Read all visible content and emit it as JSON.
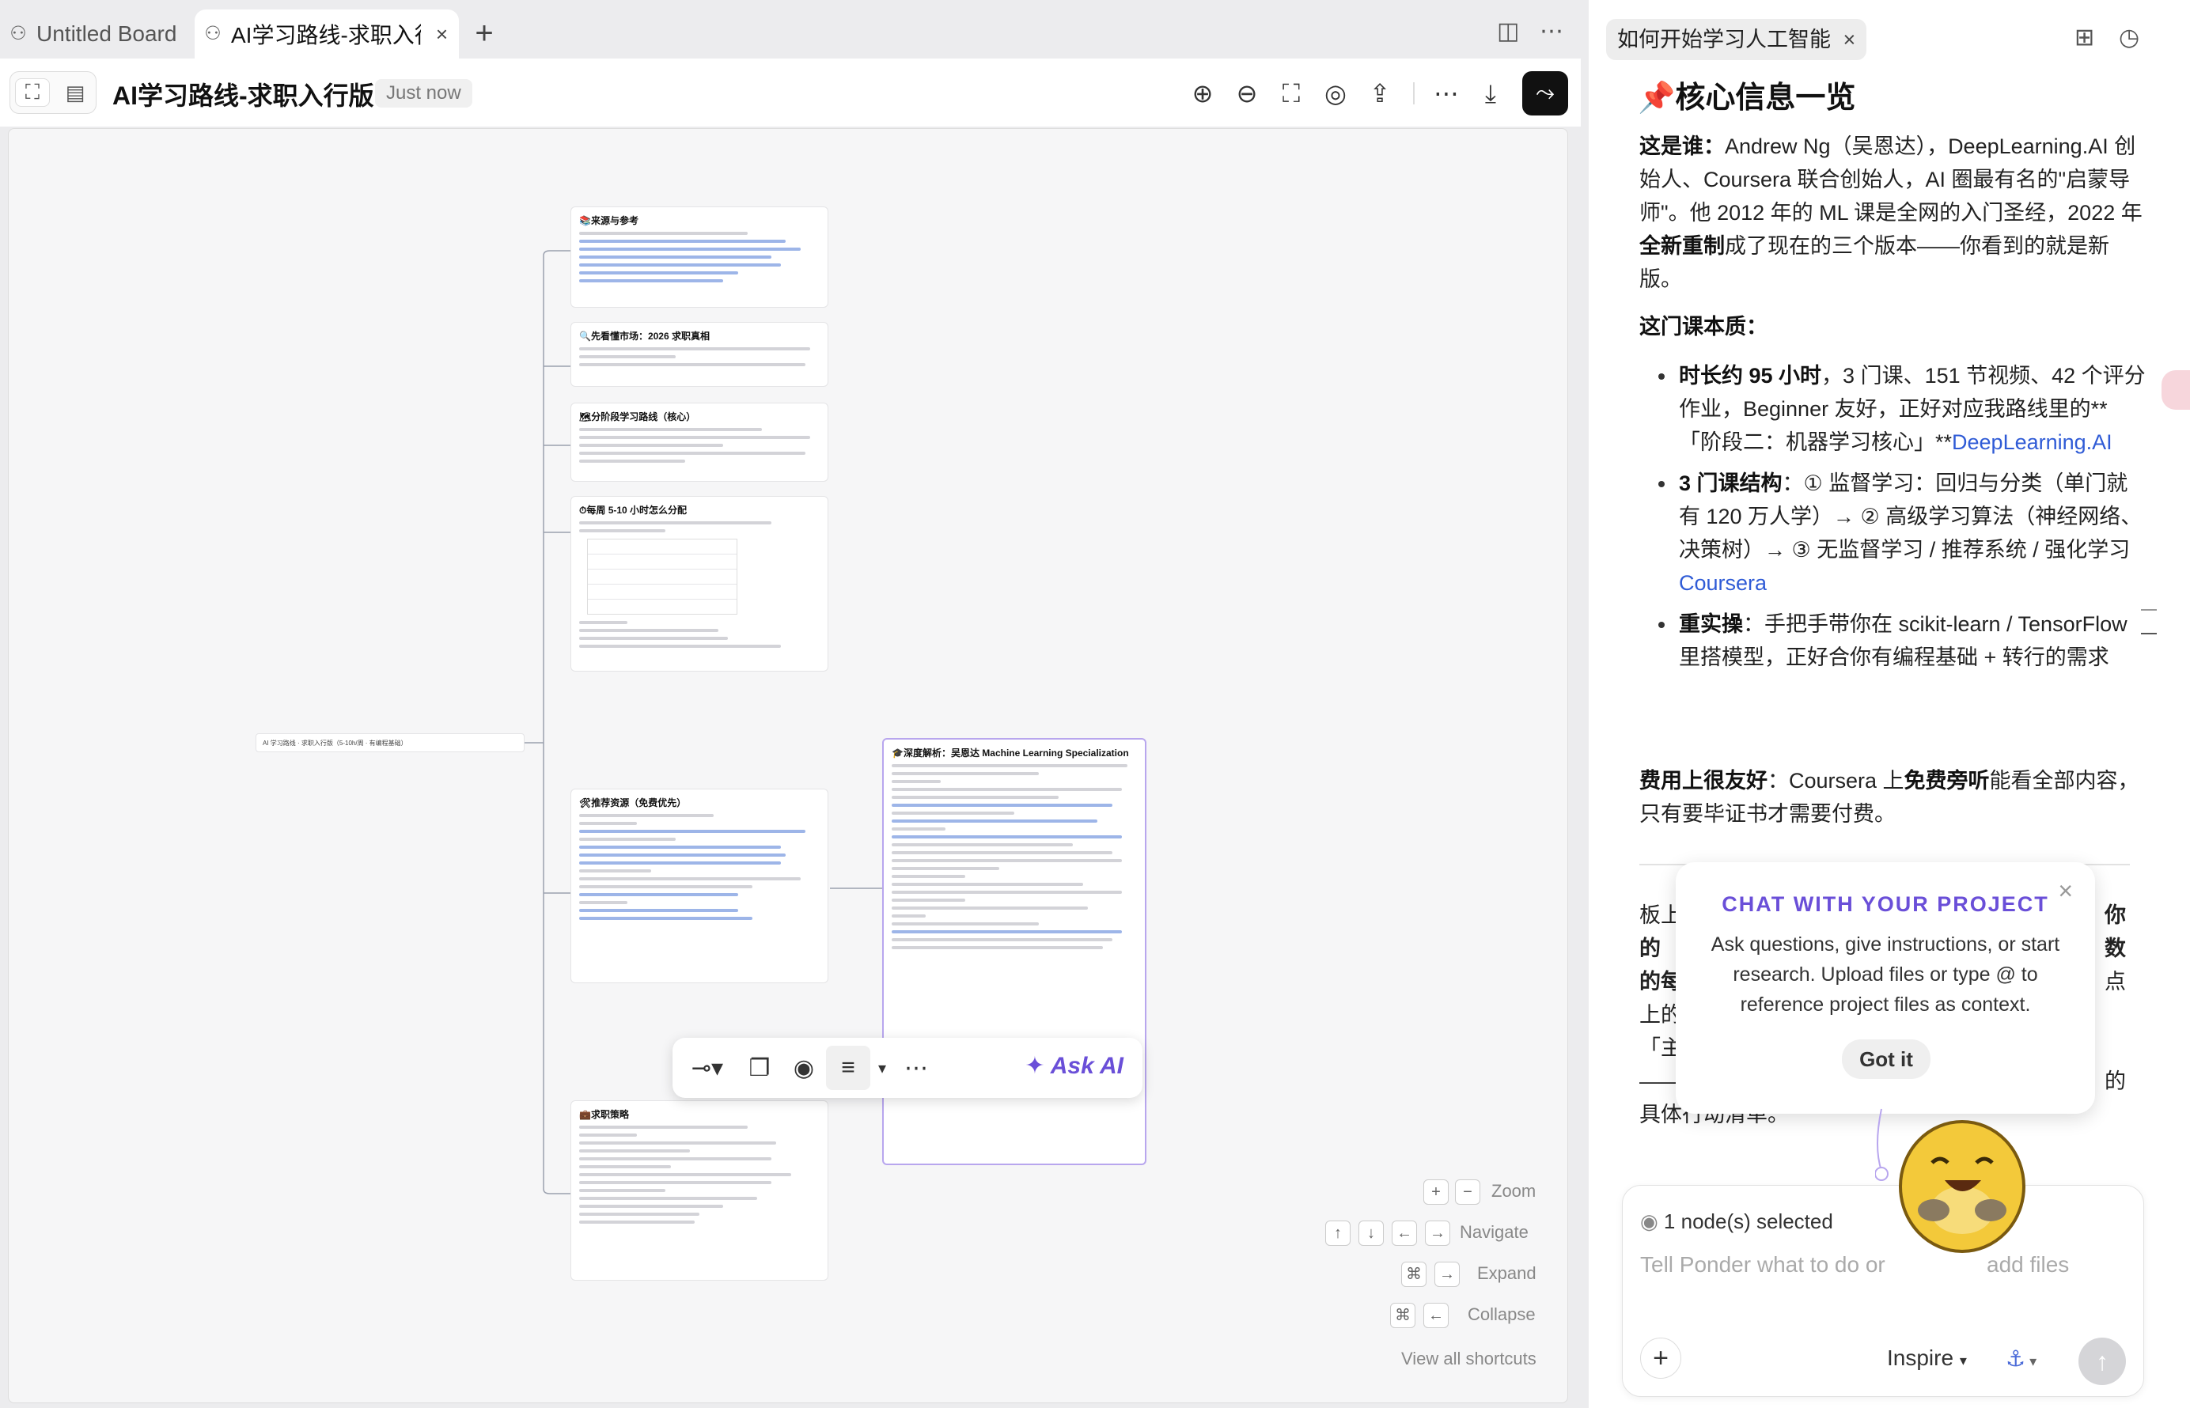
{
  "tabs": [
    {
      "label": "Untitled Board"
    },
    {
      "label": "AI学习路线-求职入行版"
    }
  ],
  "header": {
    "title": "AI学习路线-求职入行版",
    "save_status": "Just now"
  },
  "canvas": {
    "root_node": "AI 学习路线 · 求职入行版（5-10h/周 · 有编程基础）",
    "cards": [
      {
        "title": "📚来源与参考"
      },
      {
        "title": "🔍先看懂市场：2026 求职真相"
      },
      {
        "title": "🗺分阶段学习路线（核心）"
      },
      {
        "title": "⏱每周 5-10 小时怎么分配"
      },
      {
        "title": "🛠推荐资源（免费优先）"
      },
      {
        "title": "💼求职策略"
      },
      {
        "title": "🎓深度解析：吴恩达 Machine Learning Specialization"
      }
    ],
    "shortcuts": [
      {
        "label": "Zoom"
      },
      {
        "label": "Navigate"
      },
      {
        "label": "Expand"
      },
      {
        "label": "Collapse"
      }
    ],
    "view_all": "View all shortcuts"
  },
  "floating_toolbar": {
    "ask_ai": "Ask AI"
  },
  "panel": {
    "chip": "如何开始学习人工智能",
    "heading": "📌核心信息一览",
    "p1_label": "这是谁：",
    "p1_text": "Andrew Ng（吴恩达），DeepLearning.AI 创始人、Coursera 联合创始人，AI 圈最有名的\"启蒙导师\"。他 2012 年的 ML 课是全网的入门圣经，2022 年",
    "p1_bold": "全新重制",
    "p1_tail": "成了现在的三个版本——你看到的就是新版。",
    "p2_label": "这门课本质：",
    "b1_bold": "时长约 95 小时",
    "b1_text": "，3 门课、151 节视频、42 个评分作业，Beginner 友好，正好对应我路线里的**「阶段二：机器学习核心」**",
    "b1_link": "DeepLearning.AI",
    "b2_bold": "3 门课结构",
    "b2_text": "：① 监督学习：回归与分类（单门就有 120 万人学）→ ② 高级学习算法（神经网络、决策树）→ ③ 无监督学习 / 推荐系统 / 强化学习",
    "b2_link": "Coursera",
    "b3_bold": "重实操",
    "b3_text": "：手把手带你在 scikit-learn / TensorFlow 里搭模型，正好合你有编程基础 + 转行的需求",
    "p3_bold1": "费用上很友好",
    "p3_text": "：Coursera 上",
    "p3_bold2": "免费旁听",
    "p3_tail": "能看全部内容，只有要毕证书才需要付费。",
    "behind_left": [
      "板上",
      "的",
      "的每",
      "上的",
      "「主",
      "——"
    ],
    "behind_right": [
      "你",
      "数",
      "点",
      "的"
    ],
    "behind_last": "具体行动清单。",
    "popup": {
      "heading": "CHAT WITH YOUR PROJECT",
      "body": "Ask questions, give instructions, or start research. Upload files or type @ to reference project files as context.",
      "button": "Got it"
    },
    "selected": "1 node(s) selected",
    "placeholder_left": "Tell Ponder what to do or",
    "placeholder_right": "add files",
    "mode": "Inspire"
  }
}
